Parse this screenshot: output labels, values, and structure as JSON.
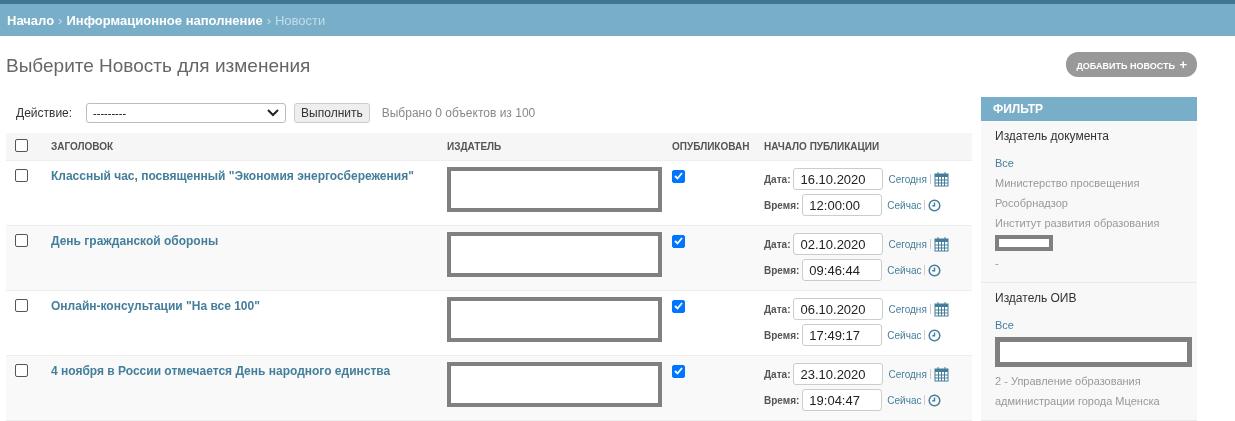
{
  "breadcrumbs": [
    {
      "label": "Начало",
      "current": false
    },
    {
      "label": "Информационное наполнение",
      "current": false
    },
    {
      "label": "Новости",
      "current": true
    }
  ],
  "breadcrumb_separator": "›",
  "page_title": "Выберите Новость для изменения",
  "add_button": {
    "label": "ДОБАВИТЬ НОВОСТЬ",
    "icon": "+"
  },
  "actions": {
    "label": "Действие:",
    "value": "---------",
    "run_button": "Выполнить",
    "counter": "Выбрано 0 объектов из 100"
  },
  "table": {
    "select_all_checked": false,
    "columns": [
      "ЗАГОЛОВОК",
      "ИЗДАТЕЛЬ",
      "ОПУБЛИКОВАН",
      "НАЧАЛО ПУБЛИКАЦИИ"
    ],
    "rows": [
      {
        "checked": false,
        "title": "Классный час, посвященный \"Экономия энергосбережения\"",
        "publisher_redacted": true,
        "published": true,
        "date_label": "Дата:",
        "date": "16.10.2020",
        "today": "Сегодня",
        "time_label": "Время:",
        "time": "12:00:00",
        "now": "Сейчас"
      },
      {
        "checked": false,
        "title": "День гражданской обороны",
        "publisher_redacted": true,
        "published": true,
        "date_label": "Дата:",
        "date": "02.10.2020",
        "today": "Сегодня",
        "time_label": "Время:",
        "time": "09:46:44",
        "now": "Сейчас"
      },
      {
        "checked": false,
        "title": "Онлайн-консультации \"На все 100\"",
        "publisher_redacted": true,
        "published": true,
        "date_label": "Дата:",
        "date": "06.10.2020",
        "today": "Сегодня",
        "time_label": "Время:",
        "time": "17:49:17",
        "now": "Сейчас"
      },
      {
        "checked": false,
        "title": "4 ноября в России отмечается День народного единства",
        "publisher_redacted": true,
        "published": true,
        "date_label": "Дата:",
        "date": "23.10.2020",
        "today": "Сегодня",
        "time_label": "Время:",
        "time": "19:04:47",
        "now": "Сейчас"
      }
    ]
  },
  "filter": {
    "title": "ФИЛЬТР",
    "groups": [
      {
        "title": "Издатель документа",
        "items": [
          {
            "kind": "text",
            "label": "Все",
            "selected": true
          },
          {
            "kind": "text",
            "label": "Министерство просвещения",
            "selected": false
          },
          {
            "kind": "text",
            "label": "Рособрнадзор",
            "selected": false
          },
          {
            "kind": "text",
            "label": "Институт развития образования",
            "selected": false
          },
          {
            "kind": "redaction_short"
          },
          {
            "kind": "text",
            "label": "-",
            "selected": false
          }
        ]
      },
      {
        "title": "Издатель ОИВ",
        "items": [
          {
            "kind": "text",
            "label": "Все",
            "selected": true
          },
          {
            "kind": "redaction_long"
          },
          {
            "kind": "text",
            "label": "2 - Управление образования администрации города Мценска",
            "selected": false
          }
        ]
      }
    ]
  }
}
